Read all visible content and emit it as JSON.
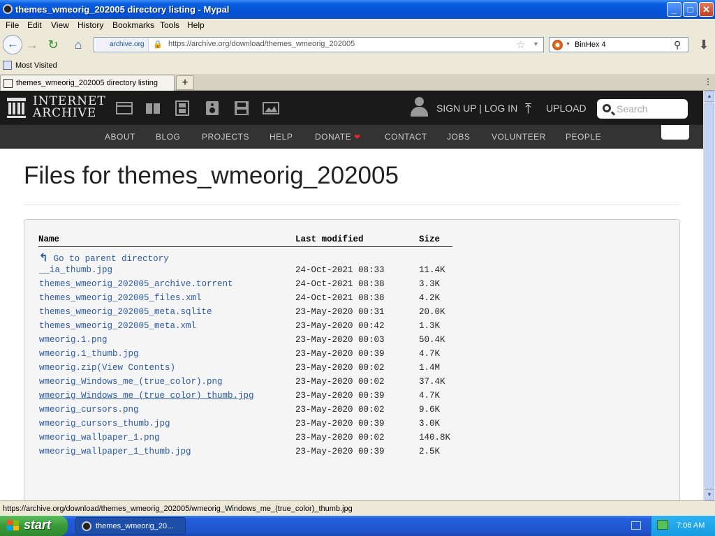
{
  "window": {
    "title": "themes_wmeorig_202005 directory listing - Mypal",
    "buttons": {
      "minimize": "_",
      "maximize": "□",
      "close": "✕"
    }
  },
  "menu": [
    "File",
    "Edit",
    "View",
    "History",
    "Bookmarks",
    "Tools",
    "Help"
  ],
  "nav": {
    "site_label": "archive.org",
    "url": "https://archive.org/download/themes_wmeorig_202005",
    "search_engine_query": "BinHex 4"
  },
  "bookmarks": {
    "most_visited": "Most Visited"
  },
  "tabs": [
    {
      "label": "themes_wmeorig_202005 directory listing"
    }
  ],
  "tab_new": "+",
  "ia_header": {
    "logo_line1": "INTERNET",
    "logo_line2": "ARCHIVE",
    "signup": "SIGN UP | LOG IN",
    "upload": "UPLOAD",
    "search_placeholder": "Search"
  },
  "ia_nav": {
    "about": "ABOUT",
    "blog": "BLOG",
    "projects": "PROJECTS",
    "help": "HELP",
    "donate": "DONATE",
    "contact": "CONTACT",
    "jobs": "JOBS",
    "volunteer": "VOLUNTEER",
    "people": "PEOPLE"
  },
  "page": {
    "title": "Files for themes_wmeorig_202005",
    "columns": {
      "name": "Name",
      "modified": "Last modified",
      "size": "Size"
    },
    "parent_link": "Go to parent directory",
    "files": [
      {
        "name": "__ia_thumb.jpg",
        "modified": "24-Oct-2021 08:33",
        "size": "11.4K"
      },
      {
        "name": "themes_wmeorig_202005_archive.torrent",
        "modified": "24-Oct-2021 08:38",
        "size": "3.3K"
      },
      {
        "name": "themes_wmeorig_202005_files.xml",
        "modified": "24-Oct-2021 08:38",
        "size": "4.2K"
      },
      {
        "name": "themes_wmeorig_202005_meta.sqlite",
        "modified": "23-May-2020 00:31",
        "size": "20.0K"
      },
      {
        "name": "themes_wmeorig_202005_meta.xml",
        "modified": "23-May-2020 00:42",
        "size": "1.3K"
      },
      {
        "name": "wmeorig.1.png",
        "modified": "23-May-2020 00:03",
        "size": "50.4K"
      },
      {
        "name": "wmeorig.1_thumb.jpg",
        "modified": "23-May-2020 00:39",
        "size": "4.7K"
      },
      {
        "name": "wmeorig.zip",
        "extra": " (View Contents)",
        "modified": "23-May-2020 00:02",
        "size": "1.4M"
      },
      {
        "name": "wmeorig_Windows_me_(true_color).png",
        "modified": "23-May-2020 00:02",
        "size": "37.4K"
      },
      {
        "name": "wmeorig_Windows_me_(true_color)_thumb.jpg",
        "modified": "23-May-2020 00:39",
        "size": "4.7K"
      },
      {
        "name": "wmeorig_cursors.png",
        "modified": "23-May-2020 00:02",
        "size": "9.6K"
      },
      {
        "name": "wmeorig_cursors_thumb.jpg",
        "modified": "23-May-2020 00:39",
        "size": "3.0K"
      },
      {
        "name": "wmeorig_wallpaper_1.png",
        "modified": "23-May-2020 00:02",
        "size": "140.8K"
      },
      {
        "name": "wmeorig_wallpaper_1_thumb.jpg",
        "modified": "23-May-2020 00:39",
        "size": "2.5K"
      }
    ]
  },
  "status": "https://archive.org/download/themes_wmeorig_202005/wmeorig_Windows_me_(true_color)_thumb.jpg",
  "taskbar": {
    "start": "start",
    "task_title": "themes_wmeorig_20...",
    "clock": "7:06 AM"
  },
  "colors": {
    "link": "#2a5aa8",
    "ia_header_bg": "#1a1a1a",
    "ia_nav_bg": "#333333",
    "donate_heart": "#e8232a"
  }
}
